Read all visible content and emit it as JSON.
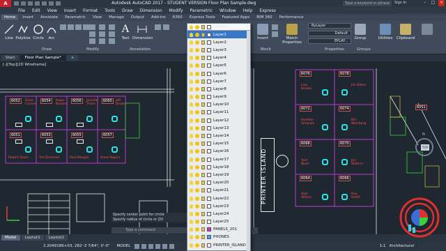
{
  "app": {
    "logo_letter": "A",
    "title": "Autodesk AutoCAD 2017 - STUDENT VERSION    Floor Plan Sample.dwg",
    "search_placeholder": "Type a keyword or phrase",
    "sign_in": "Sign In"
  },
  "menu": [
    "File",
    "Edit",
    "View",
    "Insert",
    "Format",
    "Tools",
    "Draw",
    "Dimension",
    "Modify",
    "Parametric",
    "Window",
    "Help",
    "Express"
  ],
  "ribbon_tabs": [
    "Home",
    "Insert",
    "Annotate",
    "Parametric",
    "View",
    "Manage",
    "Output",
    "Add-ins",
    "A360",
    "Express Tools",
    "Featured Apps",
    "BIM 360",
    "Performance"
  ],
  "ribbon": {
    "tools": {
      "line": "Line",
      "polyline": "Polyline",
      "circle": "Circle",
      "arc": "Arc",
      "text": "Text",
      "dimension": "Dimension",
      "insert": "Insert",
      "match_properties": "Match Properties",
      "group": "Group",
      "utilities": "Utilities",
      "clipboard": "Clipboard"
    },
    "panels": {
      "draw": "Draw",
      "modify": "Modify",
      "annotation": "Annotation",
      "block": "Block",
      "properties": "Properties",
      "groups": "Groups"
    },
    "properties": {
      "color": "ByLayer",
      "lineweight": "Default",
      "linetype": "BYLAY..."
    }
  },
  "file_tabs": [
    "Start",
    "Floor Plan Sample*"
  ],
  "viewport_label": "[-][Top][2D Wireframe]",
  "viewcube": {
    "top": "TOP",
    "north": "N"
  },
  "drawing": {
    "printer_island": "PRINTER ISLAND",
    "rooms_left": [
      {
        "tag": "6052",
        "name": "Drew Carson"
      },
      {
        "tag": "6054",
        "name": "Roger Brooks"
      },
      {
        "tag": "6056",
        "name": "Jennifer Thom"
      },
      {
        "tag": "6060",
        "name": "Jeff Brown"
      },
      {
        "tag": "6051",
        "name": "Robert Davis"
      },
      {
        "tag": "6053",
        "name": "Ted Simmons"
      },
      {
        "tag": "6055",
        "name": "Paul Morgan"
      },
      {
        "tag": "6057",
        "name": "Anne Rogers"
      }
    ],
    "rooms_right": [
      {
        "tag": "6076",
        "name": "Lisa Brooks"
      },
      {
        "tag": "6078",
        "name": "Jim Bates"
      },
      {
        "tag": "6072",
        "name": "Heather Simpson"
      },
      {
        "tag": "6074",
        "name": "Bill Weinberg"
      },
      {
        "tag": "6068",
        "name": "Terri Blum"
      },
      {
        "tag": "6070",
        "name": "Jan Walters"
      },
      {
        "tag": "6064",
        "name": "Sam Wilson"
      },
      {
        "tag": "6066",
        "name": "Ray Smith"
      }
    ],
    "extra_tag": "6051"
  },
  "layers": {
    "current": "Layer1",
    "items": [
      "Layer1",
      "Layer2",
      "Layer3",
      "Layer4",
      "Layer5",
      "Layer6",
      "Layer7",
      "Layer8",
      "Layer9",
      "Layer10",
      "Layer11",
      "Layer12",
      "Layer13",
      "Layer14",
      "Layer15",
      "Layer16",
      "Layer17",
      "Layer18",
      "Layer19",
      "Layer20",
      "Layer21",
      "Layer22",
      "Layer23",
      "Layer24",
      "Layer25",
      "PANELS_201",
      "PHONES",
      "PRINTER_ISLAND"
    ],
    "selected_index": 0,
    "colors": {
      "PANELS_201": "#cc33cc",
      "PHONES": "#4aa3ff",
      "PRINTER_ISLAND": "#ffffff"
    }
  },
  "command": {
    "history": [
      "Specify center point for circle",
      "Specify radius of circle or [Di"
    ],
    "prompt": "Type a command"
  },
  "layout_tabs": [
    "Model",
    "Layout1",
    "Layout2"
  ],
  "status": {
    "coordinates": "2.2049186+03, 282'-3 7/64\", 0'-0\"",
    "mode": "MODEL",
    "scale": "1:1",
    "units": "Architectural"
  }
}
